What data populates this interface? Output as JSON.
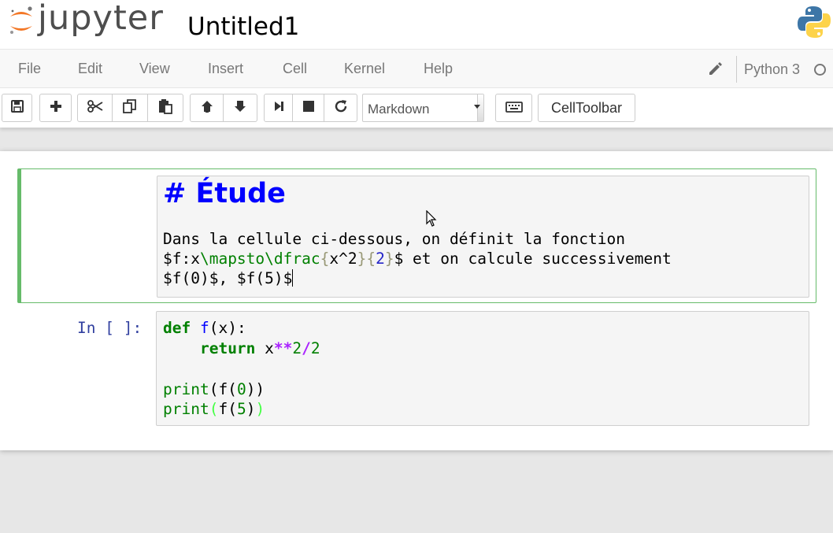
{
  "header": {
    "logo_text": "jupyter",
    "notebook_title": "Untitled1"
  },
  "menubar": {
    "items": [
      "File",
      "Edit",
      "View",
      "Insert",
      "Cell",
      "Kernel",
      "Help"
    ],
    "kernel_name": "Python 3"
  },
  "toolbar": {
    "buttons": [
      "save-icon",
      "plus-icon",
      "cut-icon",
      "copy-icon",
      "paste-icon",
      "arrow-up-icon",
      "arrow-down-icon",
      "step-forward-icon",
      "stop-icon",
      "refresh-icon",
      "keyboard-icon"
    ],
    "cell_type": "Markdown",
    "celltoolbar_label": "CellToolbar"
  },
  "cells": {
    "markdown": {
      "heading_prefix": "# ",
      "heading_text": "Étude",
      "line1": "Dans la cellule ci-dessous, on définit la fonction",
      "line2_a": "$f:x",
      "line2_cmd1": "\\mapsto\\dfrac",
      "line2_b1": "{",
      "line2_c": "x^2",
      "line2_b2": "}{",
      "line2_d": "2",
      "line2_b3": "}",
      "line2_e": "$ et on calcule successivement",
      "line3": "$f(0)$, $f(5)$"
    },
    "code": {
      "prompt": "In [ ]:",
      "line1_kw": "def",
      "line1_name": "f",
      "line1_rest": "(x):",
      "line2_indent": "    ",
      "line2_kw": "return",
      "line2_var": " x",
      "line2_op1": "**",
      "line2_n1": "2",
      "line2_op2": "/",
      "line2_n2": "2",
      "line4_fn": "print",
      "line4_a": "(f(",
      "line4_n": "0",
      "line4_b": "))",
      "line5_fn": "print",
      "line5_a": "(",
      "line5_b": "f(",
      "line5_n": "5",
      "line5_c": ")",
      "line5_d": ")"
    }
  },
  "colors": {
    "selected_cell_border": "#66bb6a",
    "prompt": "#303f9f",
    "heading": "#0000ff"
  }
}
